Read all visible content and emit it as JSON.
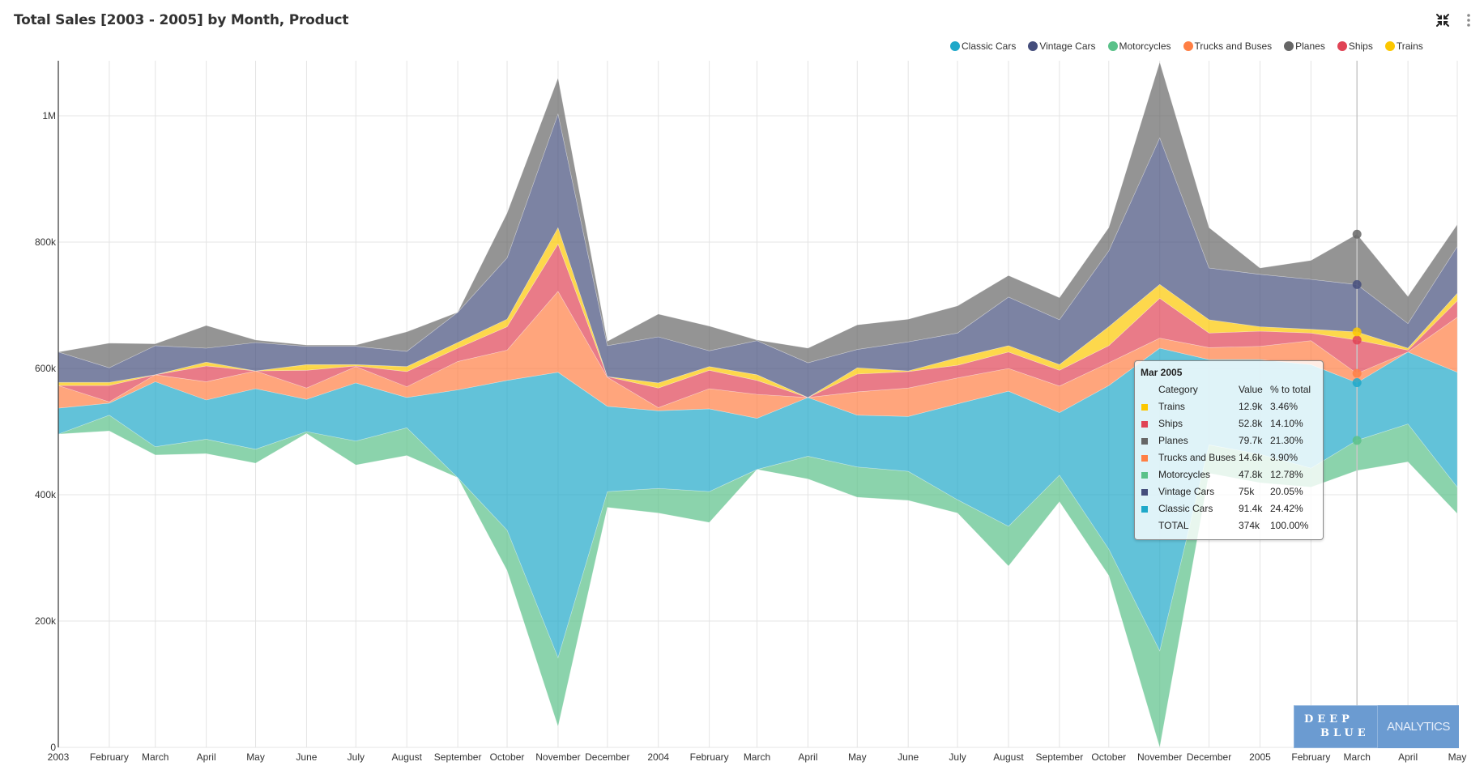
{
  "header": {
    "title": "Total Sales [2003 - 2005] by Month, Product",
    "icons": [
      "collapse-icon",
      "more-vertical-icon"
    ]
  },
  "legend": [
    {
      "label": "Classic Cars",
      "color": "#1fa8c9"
    },
    {
      "label": "Vintage Cars",
      "color": "#454e7c"
    },
    {
      "label": "Motorcycles",
      "color": "#5ac189"
    },
    {
      "label": "Trucks and Buses",
      "color": "#ff7f44"
    },
    {
      "label": "Planes",
      "color": "#666666"
    },
    {
      "label": "Ships",
      "color": "#e04355"
    },
    {
      "label": "Trains",
      "color": "#fcc700"
    }
  ],
  "tooltip": {
    "title": "Mar 2005",
    "headers": [
      "Category",
      "Value",
      "% to total"
    ],
    "rows": [
      {
        "category": "Trains",
        "value": "12.9k",
        "pct": "3.46%",
        "color": "#fcc700"
      },
      {
        "category": "Ships",
        "value": "52.8k",
        "pct": "14.10%",
        "color": "#e04355"
      },
      {
        "category": "Planes",
        "value": "79.7k",
        "pct": "21.30%",
        "color": "#666666"
      },
      {
        "category": "Trucks and Buses",
        "value": "14.6k",
        "pct": "3.90%",
        "color": "#ff7f44"
      },
      {
        "category": "Motorcycles",
        "value": "47.8k",
        "pct": "12.78%",
        "color": "#5ac189"
      },
      {
        "category": "Vintage Cars",
        "value": "75k",
        "pct": "20.05%",
        "color": "#454e7c"
      },
      {
        "category": "Classic Cars",
        "value": "91.4k",
        "pct": "24.42%",
        "color": "#1fa8c9"
      },
      {
        "category": "TOTAL",
        "value": "374k",
        "pct": "100.00%",
        "color": ""
      }
    ]
  },
  "watermark": {
    "line1": "DEEP",
    "line2": "BLUE",
    "right": "ANALYTICS"
  },
  "chart_data": {
    "type": "area",
    "subtype": "stream",
    "title": "Total Sales [2003 - 2005] by Month, Product",
    "xlabel": "",
    "ylabel": "",
    "ylim": [
      0,
      1087000
    ],
    "yticks": [
      0,
      200000,
      400000,
      600000,
      800000,
      1000000
    ],
    "ytick_labels": [
      "0",
      "200k",
      "400k",
      "600k",
      "800k",
      "1M"
    ],
    "x": [
      "2003-01",
      "2003-02",
      "2003-03",
      "2003-04",
      "2003-05",
      "2003-06",
      "2003-07",
      "2003-08",
      "2003-09",
      "2003-10",
      "2003-11",
      "2003-12",
      "2004-01",
      "2004-02",
      "2004-03",
      "2004-04",
      "2004-05",
      "2004-06",
      "2004-07",
      "2004-08",
      "2004-09",
      "2004-10",
      "2004-11",
      "2004-12",
      "2005-01",
      "2005-02",
      "2005-03",
      "2005-04",
      "2005-05"
    ],
    "xtick_labels": [
      "2003",
      "February",
      "March",
      "April",
      "May",
      "June",
      "July",
      "August",
      "September",
      "October",
      "November",
      "December",
      "2004",
      "February",
      "March",
      "April",
      "May",
      "June",
      "July",
      "August",
      "September",
      "October",
      "November",
      "December",
      "2005",
      "February",
      "March",
      "April",
      "May"
    ],
    "grid": true,
    "legend_position": "top-right",
    "stack_order_bottom_to_top": [
      "Motorcycles",
      "Classic Cars",
      "Trucks and Buses",
      "Ships",
      "Trains",
      "Vintage Cars",
      "Planes"
    ],
    "baseline": [
      496000,
      501000,
      463000,
      465000,
      450000,
      497000,
      447000,
      462000,
      427000,
      280000,
      33000,
      380000,
      371000,
      356000,
      440000,
      425000,
      396000,
      391000,
      371000,
      287000,
      389000,
      272000,
      0,
      434000,
      419000,
      412000,
      438300,
      452000,
      370000
    ],
    "series": [
      {
        "name": "Motorcycles",
        "color": "#5ac189",
        "values": [
          0,
          25000,
          13000,
          23000,
          22000,
          3000,
          38000,
          44000,
          0,
          64000,
          109000,
          25000,
          39000,
          49000,
          0,
          36000,
          48000,
          46000,
          21000,
          63000,
          42000,
          42000,
          153000,
          45000,
          45000,
          30000,
          47800,
          60000,
          42000
        ]
      },
      {
        "name": "Classic Cars",
        "color": "#1fa8c9",
        "values": [
          41000,
          19000,
          103000,
          62000,
          96000,
          51000,
          92000,
          48000,
          139000,
          237000,
          452000,
          135000,
          123000,
          131000,
          81000,
          93000,
          82000,
          87000,
          152000,
          214000,
          99000,
          259000,
          479000,
          135000,
          150000,
          164000,
          91400,
          114000,
          182000
        ]
      },
      {
        "name": "Trucks and Buses",
        "color": "#ff7f44",
        "values": [
          36000,
          2000,
          11000,
          29000,
          28000,
          18000,
          26000,
          17000,
          45000,
          48000,
          128000,
          46000,
          5000,
          32000,
          38000,
          0,
          37000,
          45000,
          41000,
          36000,
          42000,
          36000,
          16000,
          19000,
          21000,
          38000,
          14600,
          0,
          87000
        ]
      },
      {
        "name": "Ships",
        "color": "#e04355",
        "values": [
          0,
          26000,
          0,
          25000,
          0,
          28000,
          1000,
          24000,
          21000,
          37000,
          75000,
          1000,
          31000,
          29000,
          22000,
          0,
          28000,
          26000,
          20000,
          26000,
          25000,
          27000,
          63000,
          23000,
          24000,
          12000,
          52800,
          3000,
          26000
        ]
      },
      {
        "name": "Trains",
        "color": "#fcc700",
        "values": [
          5000,
          5000,
          0,
          6000,
          0,
          9000,
          2000,
          8000,
          9000,
          12000,
          26000,
          0,
          8000,
          6000,
          9000,
          0,
          10000,
          1000,
          12000,
          10000,
          9000,
          30000,
          22000,
          21000,
          7000,
          6000,
          12900,
          3000,
          12000
        ]
      },
      {
        "name": "Vintage Cars",
        "color": "#454e7c",
        "values": [
          48000,
          23000,
          46000,
          22000,
          45000,
          29000,
          29000,
          24000,
          48000,
          97000,
          180000,
          49000,
          73000,
          25000,
          54000,
          55000,
          29000,
          46000,
          39000,
          77000,
          71000,
          120000,
          232000,
          82000,
          83000,
          79000,
          75000,
          39000,
          74000
        ]
      },
      {
        "name": "Planes",
        "color": "#666666",
        "values": [
          0,
          39000,
          3000,
          36000,
          4000,
          2000,
          2000,
          31000,
          0,
          71000,
          57000,
          7000,
          36000,
          39000,
          1000,
          23000,
          39000,
          36000,
          43000,
          34000,
          35000,
          37000,
          120000,
          64000,
          10000,
          30000,
          79700,
          43000,
          35000
        ]
      }
    ],
    "highlight": {
      "x": "2005-03",
      "label": "Mar 2005",
      "total": 374000
    }
  }
}
